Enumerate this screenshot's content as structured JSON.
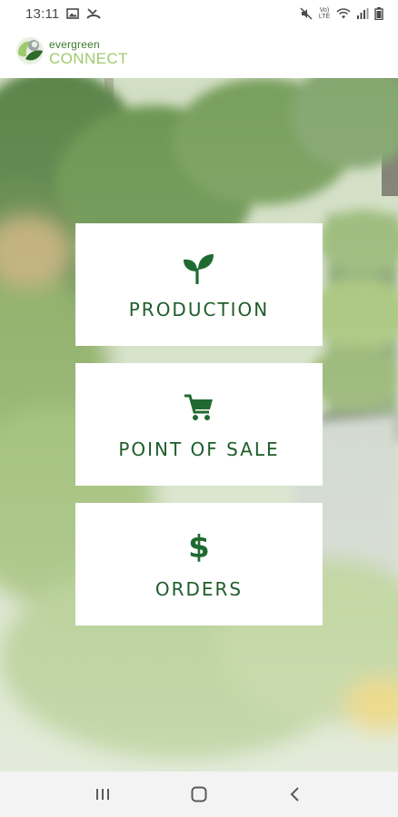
{
  "status_bar": {
    "time": "13:11",
    "icons_left": [
      "gallery-icon",
      "missed-call-icon"
    ],
    "icons_right": [
      "mute-icon",
      "volte-icon",
      "wifi-icon",
      "signal-icon",
      "battery-icon"
    ],
    "volte_label": "Vo) LTE"
  },
  "header": {
    "logo_line1": "evergreen",
    "logo_line2": "CONNECT"
  },
  "menu": {
    "items": [
      {
        "label": "PRODUCTION",
        "icon": "sprout-icon"
      },
      {
        "label": "POINT OF SALE",
        "icon": "cart-icon"
      },
      {
        "label": "ORDERS",
        "icon": "dollar-icon",
        "glyph": "$"
      }
    ]
  },
  "nav_bar": {
    "buttons": [
      "recent-apps-icon",
      "home-icon",
      "back-icon"
    ]
  },
  "colors": {
    "brand_green": "#1f5d2a",
    "logo_light_green": "#9fca6c",
    "card_background": "#ffffff"
  }
}
